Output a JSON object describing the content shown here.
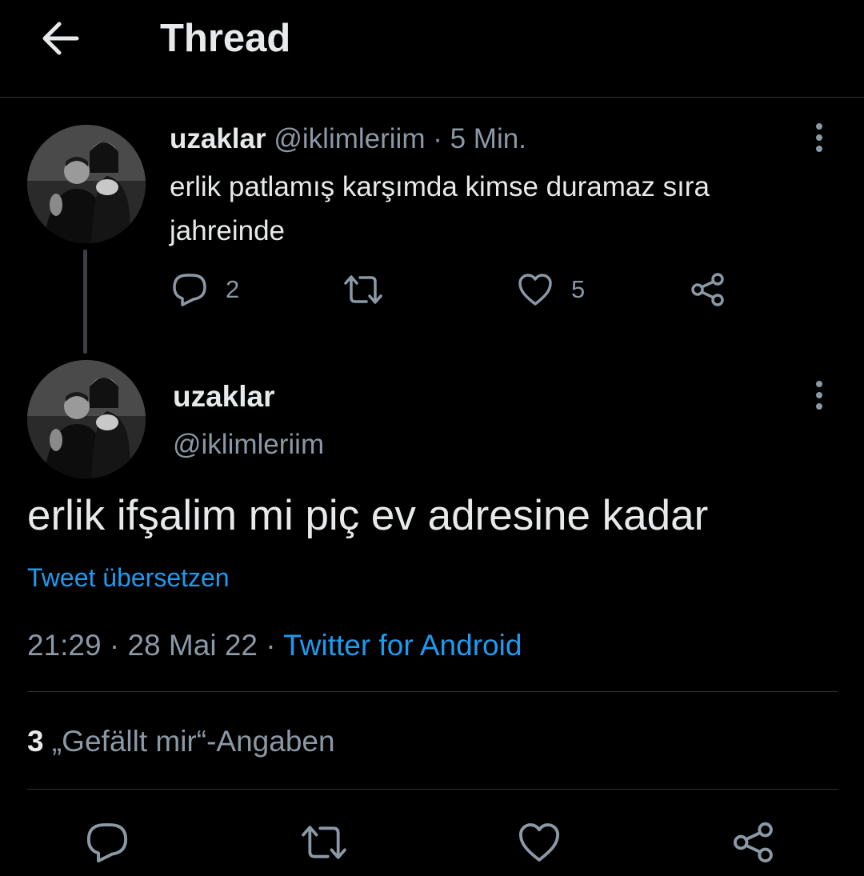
{
  "header": {
    "title": "Thread"
  },
  "parent_tweet": {
    "display_name": "uzaklar",
    "handle": "@iklimleriim",
    "separator": "·",
    "time_ago": "5 Min.",
    "text": "erlik patlamış karşımda kimse duramaz sıra jahreinde",
    "reply_count": "2",
    "retweet_count": "",
    "like_count": "5"
  },
  "main_tweet": {
    "display_name": "uzaklar",
    "handle": "@iklimleriim",
    "text": "erlik ifşalim mi piç ev adresine kadar",
    "translate_label": "Tweet übersetzen",
    "time": "21:29",
    "separator": "·",
    "date": "28 Mai 22",
    "source": "Twitter for Android",
    "likes_count": "3",
    "likes_label": "„Gefällt mir“-Angaben"
  },
  "icons": {
    "back": "arrow-left-icon",
    "more": "more-vertical-icon",
    "reply": "reply-icon",
    "retweet": "retweet-icon",
    "like": "heart-icon",
    "share": "share-icon"
  },
  "colors": {
    "background": "#000000",
    "text_primary": "#e7e9ea",
    "text_secondary": "#8b98a5",
    "link": "#1d9bf0",
    "divider": "#2f3336"
  }
}
